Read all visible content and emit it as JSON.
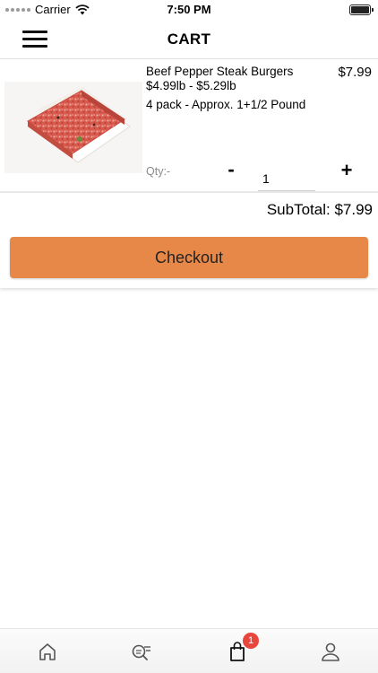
{
  "status_bar": {
    "carrier": "Carrier",
    "time": "7:50 PM"
  },
  "header": {
    "title": "CART"
  },
  "cart": {
    "items": [
      {
        "name": "Beef Pepper Steak Burgers",
        "price_range": "$4.99lb - $5.29lb",
        "pack": "4 pack - Approx. 1+1/2 Pound",
        "price": "$7.99",
        "qty_label": "Qty:-",
        "quantity": "1",
        "minus_label": "-",
        "plus_label": "+"
      }
    ],
    "subtotal": "SubTotal: $7.99",
    "checkout_label": "Checkout"
  },
  "tab_bar": {
    "tabs": [
      {
        "icon": "home-icon"
      },
      {
        "icon": "search-list-icon"
      },
      {
        "icon": "shopping-bag-icon",
        "badge": "1"
      },
      {
        "icon": "profile-icon"
      }
    ]
  },
  "colors": {
    "accent": "#e88848",
    "badge": "#e8453c"
  }
}
